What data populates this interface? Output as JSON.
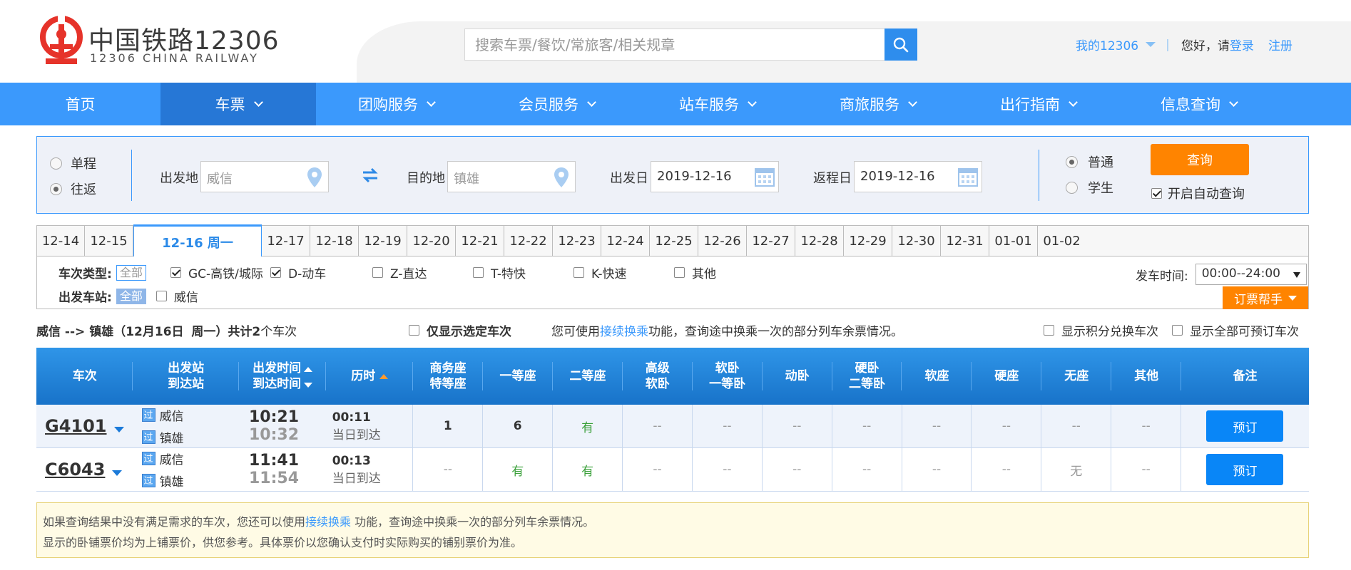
{
  "header": {
    "logo_title": "中国铁路12306",
    "logo_sub": "12306 CHINA RAILWAY",
    "search_placeholder": "搜索车票/餐饮/常旅客/相关规章",
    "my12306": "我的12306",
    "separator": "|",
    "hello": "您好，请",
    "login": "登录",
    "register": "注册"
  },
  "nav": [
    {
      "label": "首页",
      "dropdown": false
    },
    {
      "label": "车票",
      "dropdown": true,
      "active": true
    },
    {
      "label": "团购服务",
      "dropdown": true
    },
    {
      "label": "会员服务",
      "dropdown": true
    },
    {
      "label": "站车服务",
      "dropdown": true
    },
    {
      "label": "商旅服务",
      "dropdown": true
    },
    {
      "label": "出行指南",
      "dropdown": true
    },
    {
      "label": "信息查询",
      "dropdown": true
    }
  ],
  "query": {
    "one_way": "单程",
    "round_trip": "往返",
    "from_label": "出发地",
    "from_value": "威信",
    "to_label": "目的地",
    "to_value": "镇雄",
    "depart_label": "出发日",
    "depart_value": "2019-12-16",
    "return_label": "返程日",
    "return_value": "2019-12-16",
    "normal": "普通",
    "student": "学生",
    "query_btn": "查询",
    "auto_query": "开启自动查询"
  },
  "dates": [
    "12-14",
    "12-15",
    "12-16 周一",
    "12-17",
    "12-18",
    "12-19",
    "12-20",
    "12-21",
    "12-22",
    "12-23",
    "12-24",
    "12-25",
    "12-26",
    "12-27",
    "12-28",
    "12-29",
    "12-30",
    "12-31",
    "01-01",
    "01-02"
  ],
  "filter": {
    "type_label": "车次类型:",
    "all": "全部",
    "types": [
      {
        "label": "GC-高铁/城际",
        "checked": true
      },
      {
        "label": "D-动车",
        "checked": true
      },
      {
        "label": "Z-直达",
        "checked": false
      },
      {
        "label": "T-特快",
        "checked": false
      },
      {
        "label": "K-快速",
        "checked": false
      },
      {
        "label": "其他",
        "checked": false
      }
    ],
    "station_label": "出发车站:",
    "station_all": "全部",
    "station": "威信",
    "time_label": "发车时间:",
    "time_value": "00:00--24:00",
    "helper": "订票帮手"
  },
  "summary": {
    "route": "威信 --> 镇雄（",
    "date": "12月16日",
    "weekday": "周一",
    "total_pre": "）共计",
    "count": "2",
    "total_post": "个车次",
    "only_selected": "仅显示选定车次",
    "tip_pre": "您可使用",
    "tip_link": "接续换乘",
    "tip_post": "功能，查询途中换乘一次的部分列车余票情况。",
    "points": "显示积分兑换车次",
    "bookable": "显示全部可预订车次"
  },
  "table": {
    "headers": {
      "train": "车次",
      "st1": "出发站",
      "st2": "到达站",
      "tm1": "出发时间",
      "tm2": "到达时间",
      "dur": "历时",
      "biz1": "商务座",
      "biz2": "特等座",
      "first": "一等座",
      "second": "二等座",
      "hsoft1": "高级",
      "hsoft2": "软卧",
      "soft1": "软卧",
      "soft2": "一等卧",
      "dongwo": "动卧",
      "hard1": "硬卧",
      "hard2": "二等卧",
      "softseat": "软座",
      "hardseat": "硬座",
      "noseat": "无座",
      "other": "其他",
      "note": "备注"
    },
    "rows": [
      {
        "train": "G4101",
        "from": "威信",
        "to": "镇雄",
        "pass": "过",
        "dep": "10:21",
        "arr": "10:32",
        "dur": "00:11",
        "arrday": "当日到达",
        "seats": [
          "1",
          "6",
          "有",
          "--",
          "--",
          "--",
          "--",
          "--",
          "--",
          "--",
          "--"
        ],
        "book": "预订"
      },
      {
        "train": "C6043",
        "from": "威信",
        "to": "镇雄",
        "pass": "过",
        "dep": "11:41",
        "arr": "11:54",
        "dur": "00:13",
        "arrday": "当日到达",
        "seats": [
          "--",
          "有",
          "有",
          "--",
          "--",
          "--",
          "--",
          "--",
          "--",
          "无",
          "--"
        ],
        "book": "预订"
      }
    ]
  },
  "notice": {
    "line1_pre": "如果查询结果中没有满足需求的车次，您还可以使用",
    "line1_link": "接续换乘",
    "line1_post": " 功能，查询途中换乘一次的部分列车余票情况。",
    "line2": "显示的卧铺票价均为上铺票价，供您参考。具体票价以您确认支付时实际购买的铺别票价为准。"
  },
  "colors": {
    "brand": "#3b99fc",
    "accent": "#ff8400",
    "logo_red": "#e6332a"
  }
}
